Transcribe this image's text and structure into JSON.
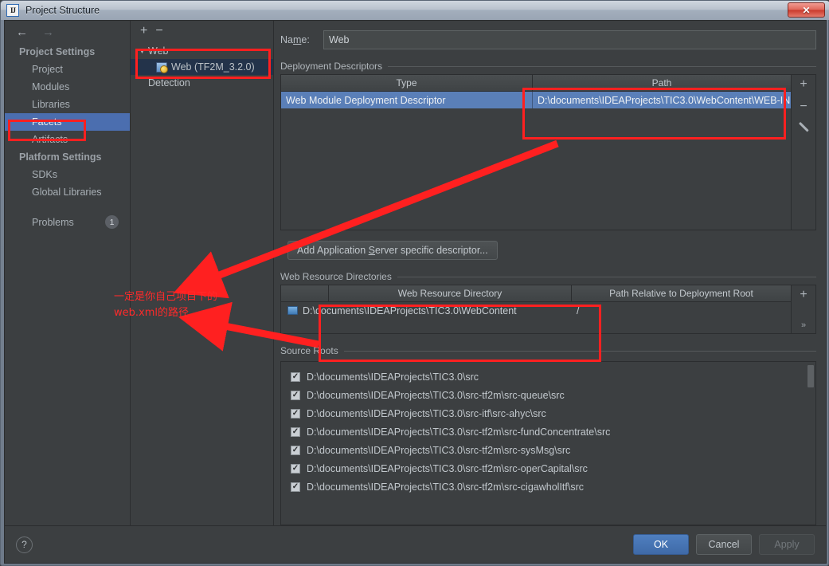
{
  "window": {
    "title": "Project Structure",
    "app_icon": "intellij-idea-icon",
    "close_label": "✕"
  },
  "sidebar": {
    "nav": {
      "back": "←",
      "forward": "→"
    },
    "groups": [
      {
        "label": "Project Settings",
        "items": [
          {
            "label": "Project",
            "selected": false
          },
          {
            "label": "Modules",
            "selected": false
          },
          {
            "label": "Libraries",
            "selected": false
          },
          {
            "label": "Facets",
            "selected": true
          },
          {
            "label": "Artifacts",
            "selected": false
          }
        ]
      },
      {
        "label": "Platform Settings",
        "items": [
          {
            "label": "SDKs",
            "selected": false
          },
          {
            "label": "Global Libraries",
            "selected": false
          }
        ]
      }
    ],
    "problems": {
      "label": "Problems",
      "count": "1"
    }
  },
  "tree_panel": {
    "toolbar": {
      "add": "+",
      "remove": "−"
    },
    "nodes": [
      {
        "label": "Web",
        "type": "group",
        "expanded": true,
        "selected": false
      },
      {
        "label": "Web (TF2M_3.2.0)",
        "type": "facet",
        "selected": true
      },
      {
        "label": "Detection",
        "type": "group",
        "selected": false
      }
    ]
  },
  "main": {
    "name": {
      "label_pre": "Na",
      "label_mnemonic": "m",
      "label_post": "e:",
      "value": "Web"
    },
    "deployment_descriptors": {
      "title": "Deployment Descriptors",
      "columns": [
        "Type",
        "Path"
      ],
      "rows": [
        {
          "type": "Web Module Deployment Descriptor",
          "path": "D:\\documents\\IDEAProjects\\TIC3.0\\WebContent\\WEB-IN",
          "selected": true
        }
      ],
      "tools": {
        "add": "+",
        "remove": "−",
        "edit": "pencil-icon"
      }
    },
    "add_descriptor_button": {
      "pre": "Add Application ",
      "mnemonic": "S",
      "post": "erver specific descriptor..."
    },
    "web_resource_directories": {
      "title": "Web Resource Directories",
      "columns": [
        "Web Resource Directory",
        "Path Relative to Deployment Root"
      ],
      "rows": [
        {
          "directory": "D:\\documents\\IDEAProjects\\TIC3.0\\WebContent",
          "relative_path": "/"
        }
      ],
      "tools": {
        "add": "+",
        "more": "»"
      }
    },
    "source_roots": {
      "title": "Source Roots",
      "items": [
        {
          "label": "D:\\documents\\IDEAProjects\\TIC3.0\\src",
          "checked": true
        },
        {
          "label": "D:\\documents\\IDEAProjects\\TIC3.0\\src-tf2m\\src-queue\\src",
          "checked": true
        },
        {
          "label": "D:\\documents\\IDEAProjects\\TIC3.0\\src-itf\\src-ahyc\\src",
          "checked": true
        },
        {
          "label": "D:\\documents\\IDEAProjects\\TIC3.0\\src-tf2m\\src-fundConcentrate\\src",
          "checked": true
        },
        {
          "label": "D:\\documents\\IDEAProjects\\TIC3.0\\src-tf2m\\src-sysMsg\\src",
          "checked": true
        },
        {
          "label": "D:\\documents\\IDEAProjects\\TIC3.0\\src-tf2m\\src-operCapital\\src",
          "checked": true
        },
        {
          "label": "D:\\documents\\IDEAProjects\\TIC3.0\\src-tf2m\\src-cigawholItf\\src",
          "checked": true
        }
      ],
      "checkmark": "✓"
    }
  },
  "bottom_bar": {
    "help": "?",
    "ok": "OK",
    "cancel": "Cancel",
    "apply": "Apply"
  },
  "annotation": {
    "line1": "一定是你自己项目下的",
    "line2": "web.xml的路径",
    "color": "#ff2a2a"
  }
}
